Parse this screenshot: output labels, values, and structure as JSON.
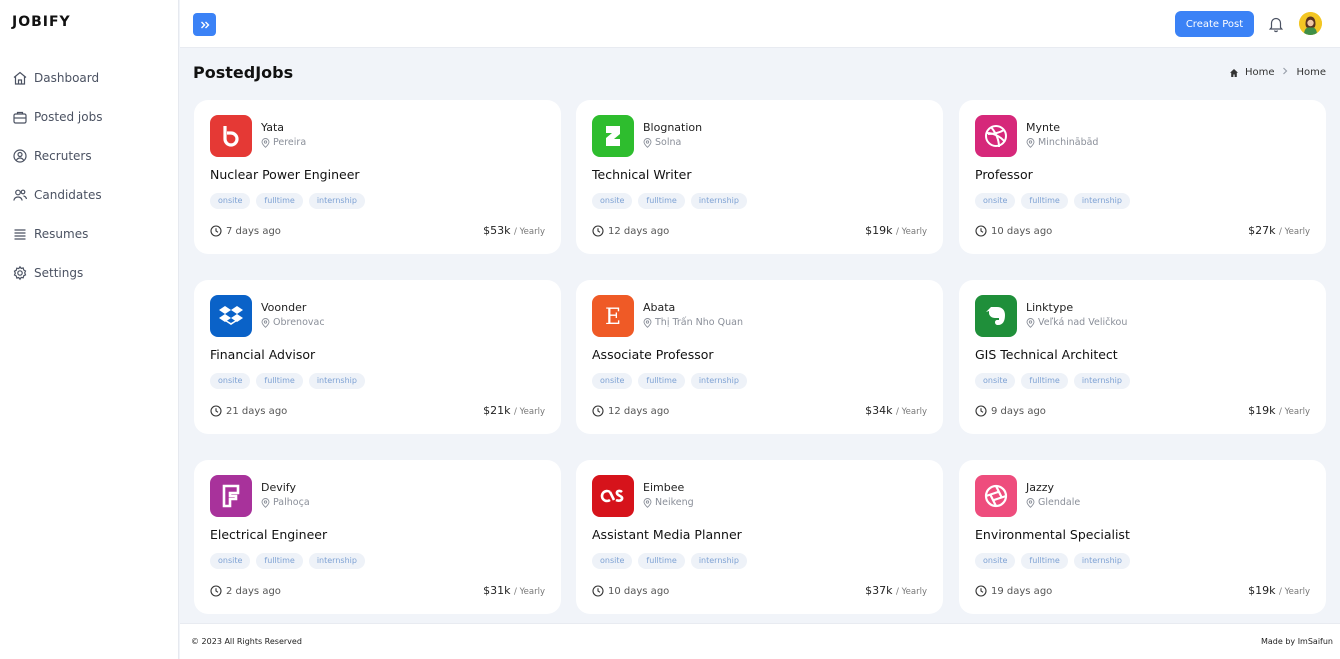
{
  "brand": "JOBIFY",
  "nav": [
    {
      "label": "Dashboard",
      "icon": "home-icon"
    },
    {
      "label": "Posted jobs",
      "icon": "briefcase-icon"
    },
    {
      "label": "Recruters",
      "icon": "user-circle-icon"
    },
    {
      "label": "Candidates",
      "icon": "users-icon"
    },
    {
      "label": "Resumes",
      "icon": "list-icon"
    },
    {
      "label": "Settings",
      "icon": "gear-icon"
    }
  ],
  "topbar": {
    "create_label": "Create Post"
  },
  "page": {
    "title": "PostedJobs",
    "breadcrumb": [
      "Home",
      "Home"
    ]
  },
  "tags": [
    "onsite",
    "fulltime",
    "internship"
  ],
  "jobs": [
    {
      "company": "Yata",
      "location": "Pereira",
      "title": "Nuclear Power Engineer",
      "posted": "7 days ago",
      "salary": "$53k",
      "period": "/ Yearly",
      "logo_color": "#e53935"
    },
    {
      "company": "Blognation",
      "location": "Solna",
      "title": "Technical Writer",
      "posted": "12 days ago",
      "salary": "$19k",
      "period": "/ Yearly",
      "logo_color": "#2ebd2e"
    },
    {
      "company": "Mynte",
      "location": "Minchinābād",
      "title": "Professor",
      "posted": "10 days ago",
      "salary": "$27k",
      "period": "/ Yearly",
      "logo_color": "#d6287a"
    },
    {
      "company": "Voonder",
      "location": "Obrenovac",
      "title": "Financial Advisor",
      "posted": "21 days ago",
      "salary": "$21k",
      "period": "/ Yearly",
      "logo_color": "#0a62c8"
    },
    {
      "company": "Abata",
      "location": "Thị Trấn Nho Quan",
      "title": "Associate Professor",
      "posted": "12 days ago",
      "salary": "$34k",
      "period": "/ Yearly",
      "logo_color": "#ef5a26"
    },
    {
      "company": "Linktype",
      "location": "Veľká nad Veličkou",
      "title": "GIS Technical Architect",
      "posted": "9 days ago",
      "salary": "$19k",
      "period": "/ Yearly",
      "logo_color": "#1f8f3a"
    },
    {
      "company": "Devify",
      "location": "Palhoça",
      "title": "Electrical Engineer",
      "posted": "2 days ago",
      "salary": "$31k",
      "period": "/ Yearly",
      "logo_color": "#a8329b"
    },
    {
      "company": "Eimbee",
      "location": "Neikeng",
      "title": "Assistant Media Planner",
      "posted": "10 days ago",
      "salary": "$37k",
      "period": "/ Yearly",
      "logo_color": "#d6131b"
    },
    {
      "company": "Jazzy",
      "location": "Glendale",
      "title": "Environmental Specialist",
      "posted": "19 days ago",
      "salary": "$19k",
      "period": "/ Yearly",
      "logo_color": "#ee4d7d"
    }
  ],
  "footer": {
    "left": "© 2023 All Rights Reserved",
    "right": "Made by ImSaifun"
  }
}
